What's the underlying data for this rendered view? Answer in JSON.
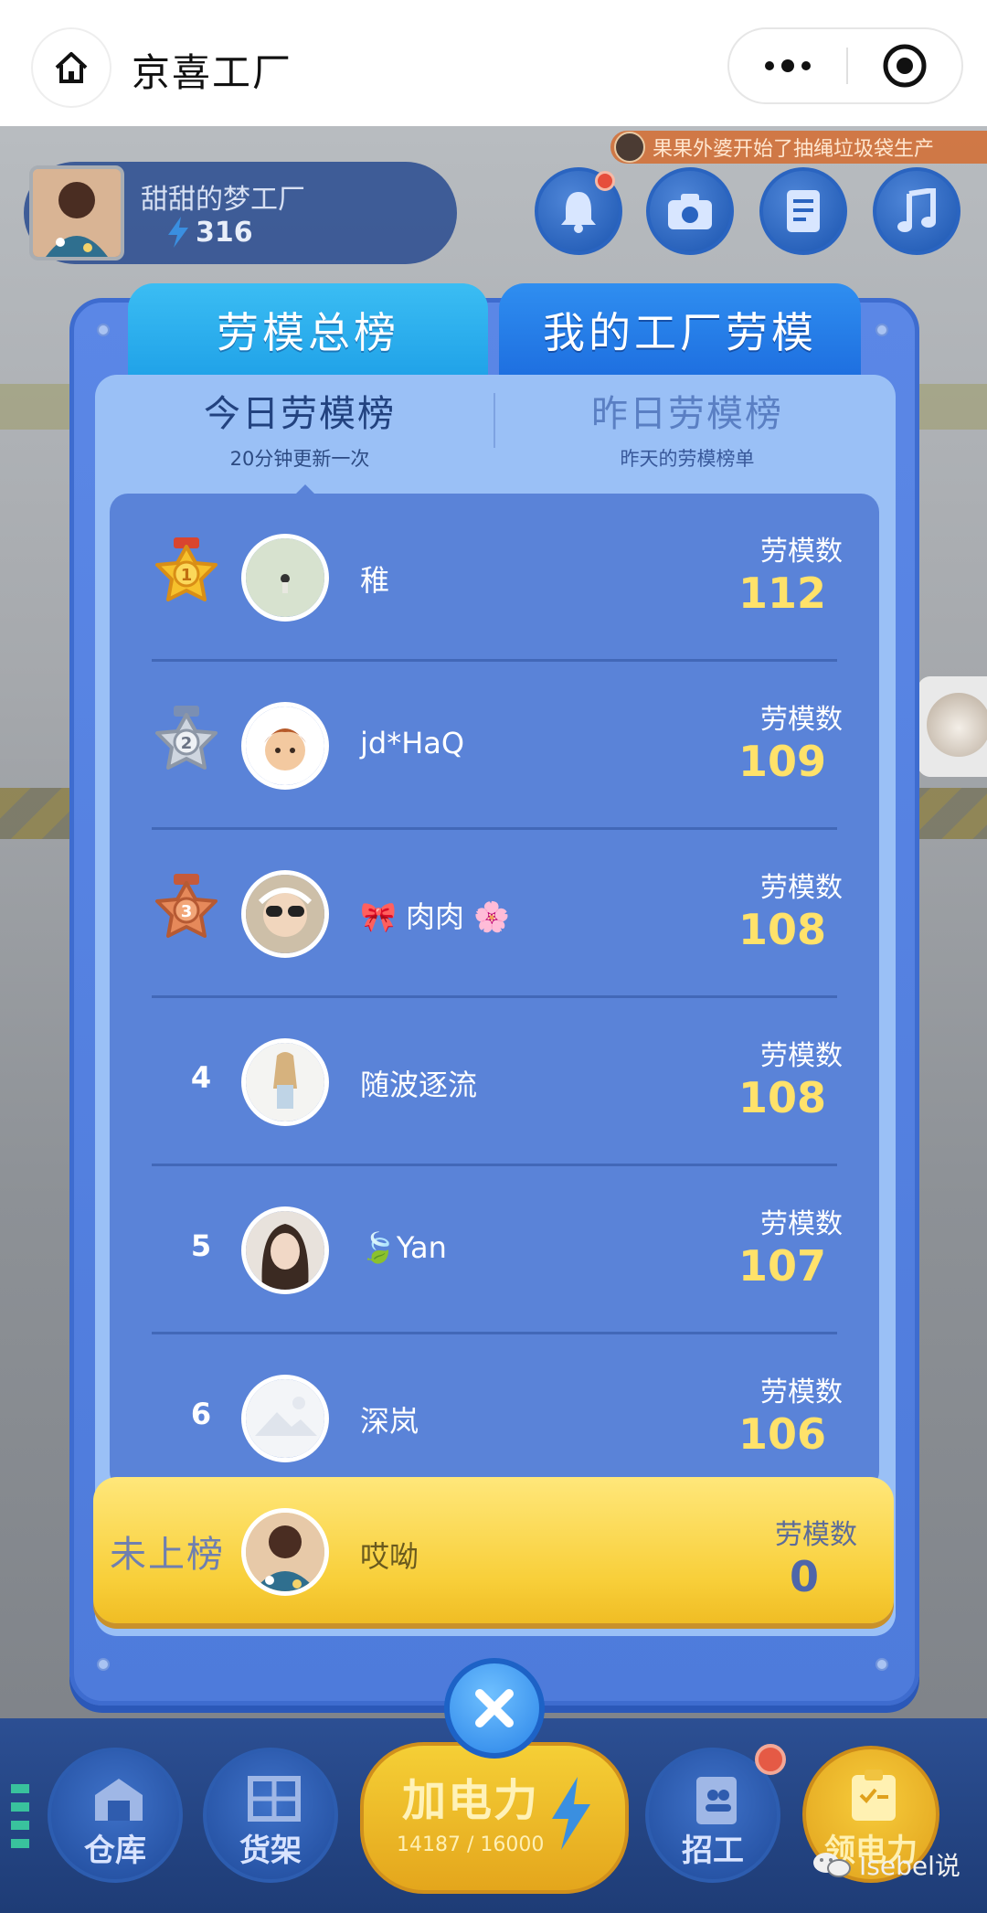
{
  "topbar": {
    "title": "京喜工厂"
  },
  "ticker": {
    "text": "果果外婆开始了抽绳垃圾袋生产"
  },
  "profile": {
    "name": "甜甜的梦工厂",
    "score": "316"
  },
  "header_buttons": [
    "bell-icon",
    "camera-icon",
    "document-icon",
    "music-icon"
  ],
  "tabs": [
    {
      "label": "劳模总榜",
      "active": true
    },
    {
      "label": "我的工厂劳模",
      "active": false
    }
  ],
  "subtabs": {
    "today": {
      "title": "今日劳模榜",
      "subtitle": "20分钟更新一次"
    },
    "yesterday": {
      "title": "昨日劳模榜",
      "subtitle": "昨天的劳模榜单"
    }
  },
  "score_label": "劳模数",
  "ranking": [
    {
      "rank": "1",
      "medal": "gold",
      "name": "稚",
      "score": "112"
    },
    {
      "rank": "2",
      "medal": "silver",
      "name": "jd*HaQ",
      "score": "109"
    },
    {
      "rank": "3",
      "medal": "bronze",
      "name": "🎀 肉肉 🌸",
      "score": "108"
    },
    {
      "rank": "4",
      "medal": "",
      "name": "随波逐流",
      "score": "108"
    },
    {
      "rank": "5",
      "medal": "",
      "name": "🍃Yan",
      "score": "107"
    },
    {
      "rank": "6",
      "medal": "",
      "name": "深岚",
      "score": "106"
    }
  ],
  "mine": {
    "tag": "未上榜",
    "name": "哎呦",
    "score_label": "劳模数",
    "score": "0"
  },
  "bottom_nav": {
    "warehouse": "仓库",
    "shelf": "货架",
    "power_label": "加电力",
    "power_value": "14187 / 16000",
    "recruit": "招工",
    "collect": "领电力"
  },
  "watermark": "Isebel说",
  "colors": {
    "modal_blue": "#5a83d8",
    "score_yellow": "#ffe26a",
    "tab_cyan": "#20a2e8",
    "mine_yellow": "#f8cf3a"
  }
}
